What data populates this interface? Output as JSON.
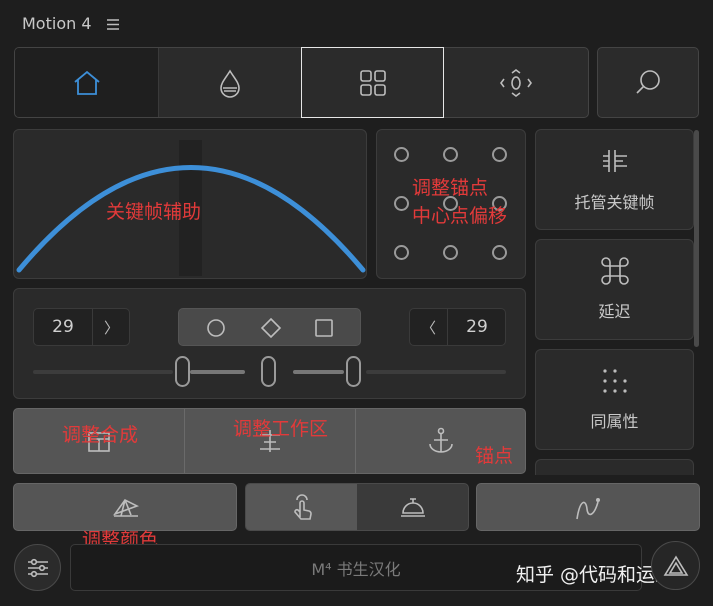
{
  "header": {
    "title": "Motion 4"
  },
  "tabs": [
    {
      "name": "home",
      "icon": "home-icon",
      "active": true
    },
    {
      "name": "color",
      "icon": "drop-icon",
      "active": false
    },
    {
      "name": "grid",
      "icon": "grid-icon",
      "active": false,
      "selected": true
    },
    {
      "name": "align",
      "icon": "align-icon",
      "active": false
    }
  ],
  "search": {
    "icon": "search-icon"
  },
  "curve_panel": {
    "annotation": "关键帧辅助"
  },
  "anchor_panel": {
    "annotation_line1": "调整锚点",
    "annotation_line2": "中心点偏移"
  },
  "side_buttons": [
    {
      "label": "托管关键帧",
      "icon": "keyframe-manage-icon"
    },
    {
      "label": "延迟",
      "icon": "command-icon"
    },
    {
      "label": "同属性",
      "icon": "dots-icon"
    }
  ],
  "timing": {
    "left_value": "29",
    "right_value": "29",
    "left_arrow": "〉",
    "right_arrow": "〈",
    "shapes": [
      "circle-shape",
      "diamond-shape",
      "square-shape"
    ]
  },
  "annotations": {
    "compose": "调整合成",
    "workarea": "调整工作区",
    "anchor": "锚点",
    "color": "调整颜色"
  },
  "footer": {
    "brand": "M⁴ 书生汉化",
    "watermark": "知乎 @代码和运维"
  },
  "colors": {
    "accent": "#3d8fd8",
    "annotation": "#e23a3a"
  }
}
